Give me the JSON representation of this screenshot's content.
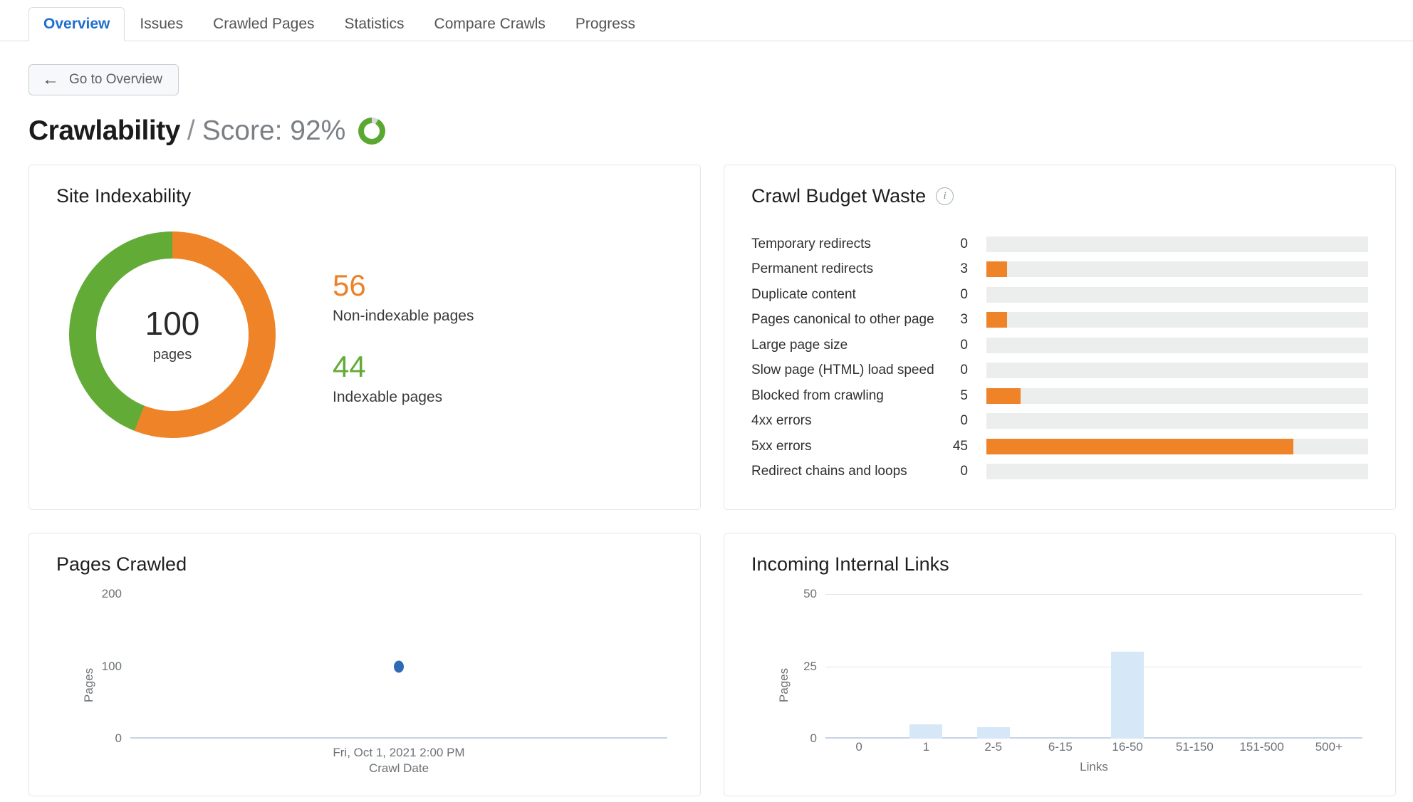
{
  "tabs": [
    {
      "label": "Overview",
      "active": true
    },
    {
      "label": "Issues",
      "active": false
    },
    {
      "label": "Crawled Pages",
      "active": false
    },
    {
      "label": "Statistics",
      "active": false
    },
    {
      "label": "Compare Crawls",
      "active": false
    },
    {
      "label": "Progress",
      "active": false
    }
  ],
  "back_button": {
    "label": "Go to Overview",
    "arrow": "←"
  },
  "header": {
    "title": "Crawlability",
    "separator": "/",
    "score_text": "Score: 92%",
    "score_percent": 92,
    "score_color": "#5aa832"
  },
  "colors": {
    "orange": "#ee8327",
    "green": "#63ab37",
    "blue": "#2d6cb5",
    "bar_light_blue": "#d6e7f7",
    "track_gray": "#eceded",
    "accent_tab": "#1f6fd0"
  },
  "site_indexability": {
    "title": "Site Indexability",
    "total": "100",
    "total_unit": "pages",
    "non_indexable": {
      "value": "56",
      "label": "Non-indexable pages",
      "color": "#ee8327"
    },
    "indexable": {
      "value": "44",
      "label": "Indexable pages",
      "color": "#63ab37"
    }
  },
  "crawl_budget_waste": {
    "title": "Crawl Budget Waste",
    "info_icon": "info-icon",
    "max_value": 56,
    "rows": [
      {
        "name": "Temporary redirects",
        "value": "0",
        "num": 0
      },
      {
        "name": "Permanent redirects",
        "value": "3",
        "num": 3
      },
      {
        "name": "Duplicate content",
        "value": "0",
        "num": 0
      },
      {
        "name": "Pages canonical to other page",
        "value": "3",
        "num": 3
      },
      {
        "name": "Large page size",
        "value": "0",
        "num": 0
      },
      {
        "name": "Slow page (HTML) load speed",
        "value": "0",
        "num": 0
      },
      {
        "name": "Blocked from crawling",
        "value": "5",
        "num": 5
      },
      {
        "name": "4xx errors",
        "value": "0",
        "num": 0
      },
      {
        "name": "5xx errors",
        "value": "45",
        "num": 45
      },
      {
        "name": "Redirect chains and loops",
        "value": "0",
        "num": 0
      }
    ]
  },
  "pages_crawled": {
    "title": "Pages Crawled"
  },
  "incoming_internal_links": {
    "title": "Incoming Internal Links"
  },
  "chart_data": [
    {
      "type": "scatter",
      "title": "Pages Crawled",
      "xlabel": "Crawl Date",
      "ylabel": "Pages",
      "ylim": [
        0,
        200
      ],
      "yticks": [
        "0",
        "100",
        "200"
      ],
      "ytick_values": [
        0,
        100,
        200
      ],
      "grid": false,
      "x": [
        "Fri, Oct 1, 2021 2:00 PM"
      ],
      "values": [
        100
      ],
      "point_color": "#2d6cb5"
    },
    {
      "type": "bar",
      "title": "Incoming Internal Links",
      "xlabel": "Links",
      "ylabel": "Pages",
      "ylim": [
        0,
        50
      ],
      "yticks": [
        "0",
        "25",
        "50"
      ],
      "ytick_values": [
        0,
        25,
        50
      ],
      "grid": true,
      "categories": [
        "0",
        "1",
        "2-5",
        "6-15",
        "16-50",
        "51-150",
        "151-500",
        "500+"
      ],
      "values": [
        0,
        5,
        4,
        0,
        30,
        0,
        0,
        0
      ],
      "bar_color": "#d6e7f7"
    }
  ]
}
